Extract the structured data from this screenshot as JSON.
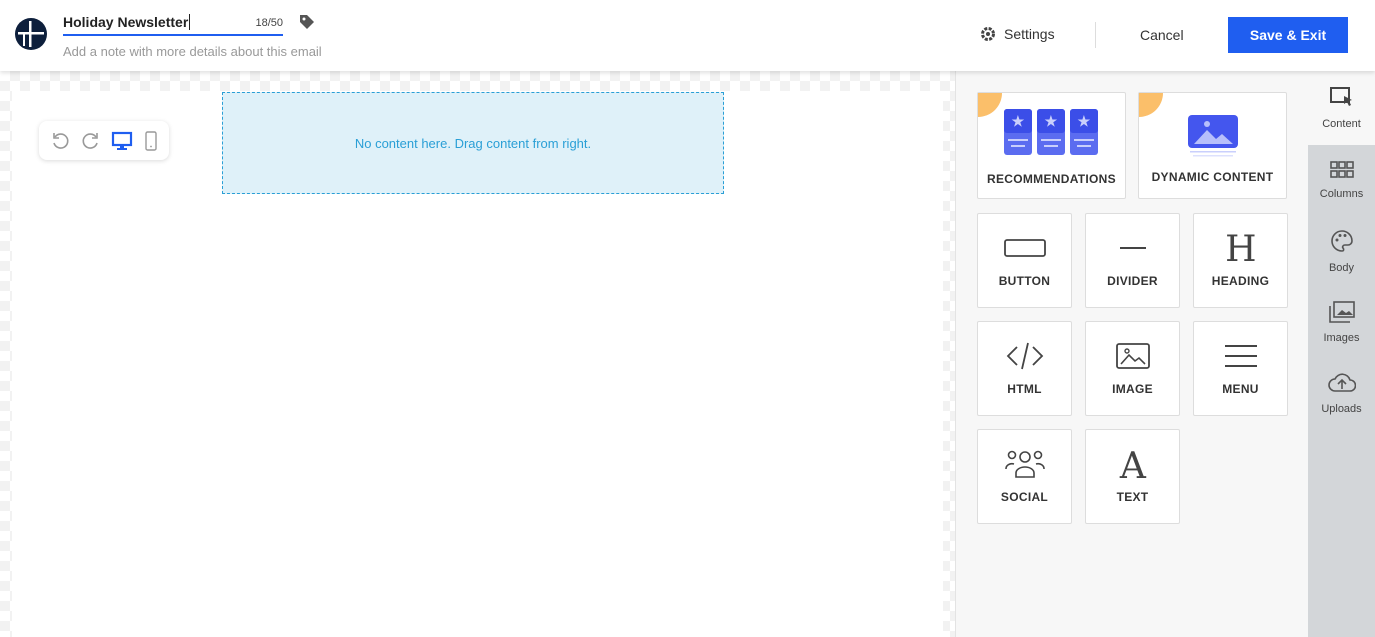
{
  "header": {
    "title": "Holiday Newsletter",
    "char_count": "18/50",
    "note_placeholder": "Add a note with more details about this email",
    "settings_label": "Settings",
    "cancel_label": "Cancel",
    "save_label": "Save & Exit"
  },
  "canvas": {
    "empty_message": "No content here. Drag content from right.",
    "active_view": "desktop"
  },
  "content": {
    "premium_tiles": [
      {
        "label": "RECOMMENDATIONS",
        "icon": "recommendations-icon"
      },
      {
        "label": "DYNAMIC CONTENT",
        "icon": "dynamic-content-icon"
      }
    ],
    "tiles": [
      {
        "label": "BUTTON",
        "icon": "button-icon"
      },
      {
        "label": "DIVIDER",
        "icon": "divider-icon"
      },
      {
        "label": "HEADING",
        "icon": "heading-icon"
      },
      {
        "label": "HTML",
        "icon": "code-icon"
      },
      {
        "label": "IMAGE",
        "icon": "image-icon"
      },
      {
        "label": "MENU",
        "icon": "menu-icon"
      },
      {
        "label": "SOCIAL",
        "icon": "social-icon"
      },
      {
        "label": "TEXT",
        "icon": "text-icon"
      }
    ]
  },
  "rail": [
    {
      "label": "Content",
      "active": true
    },
    {
      "label": "Columns"
    },
    {
      "label": "Body"
    },
    {
      "label": "Images"
    },
    {
      "label": "Uploads"
    }
  ],
  "colors": {
    "accent": "#1f5ef0",
    "drop_zone": "#dff1f9",
    "premium_badge": "#fbbf6a"
  }
}
